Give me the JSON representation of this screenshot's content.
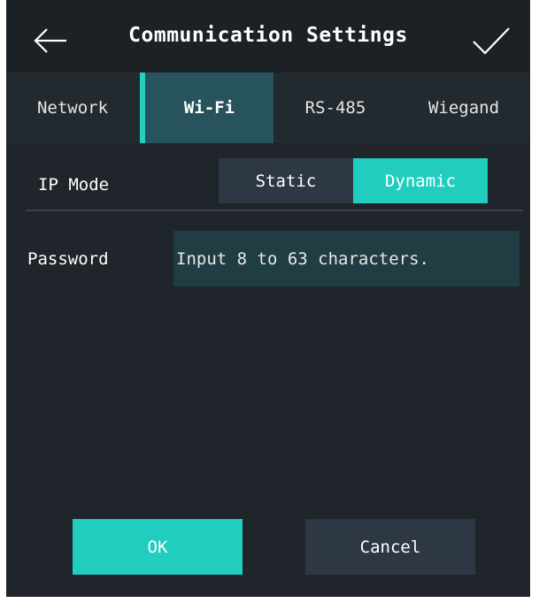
{
  "header": {
    "title": "Communication Settings",
    "back_icon": "arrow-left-icon",
    "confirm_icon": "checkmark-icon"
  },
  "tabs": [
    {
      "label": "Network",
      "active": false
    },
    {
      "label": "Wi-Fi",
      "active": true
    },
    {
      "label": "RS-485",
      "active": false
    },
    {
      "label": "Wiegand",
      "active": false
    }
  ],
  "ip_mode": {
    "label": "IP Mode",
    "options": [
      "Static",
      "Dynamic"
    ],
    "selected": "Dynamic"
  },
  "password": {
    "label": "Password",
    "placeholder": "Input 8 to 63 characters.",
    "value": ""
  },
  "buttons": {
    "ok": "OK",
    "cancel": "Cancel"
  },
  "colors": {
    "background": "#1f252b",
    "accent": "#21cdbe",
    "active_tab": "#27535d",
    "secondary_button": "#2d3844",
    "input_background": "#1f3d42"
  }
}
